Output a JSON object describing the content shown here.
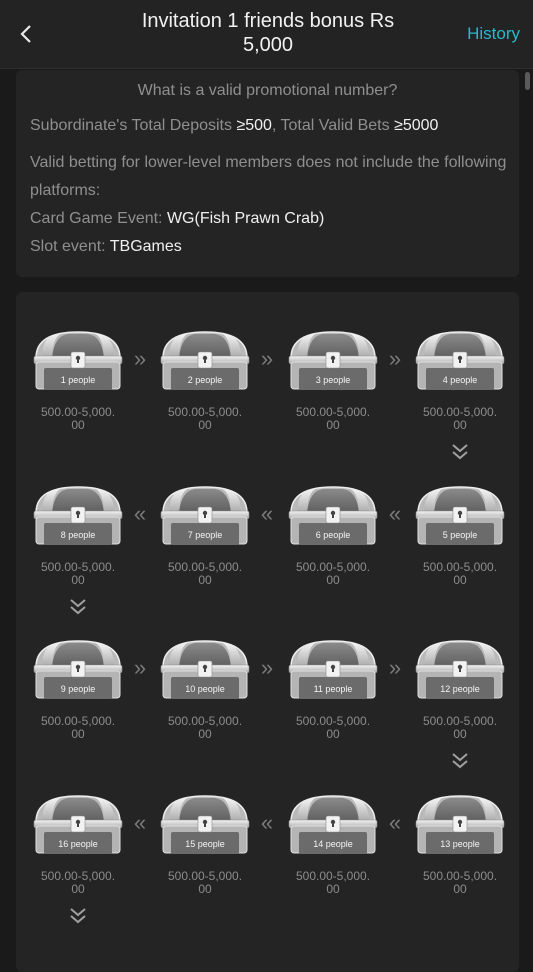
{
  "header": {
    "title_line1": "Invitation 1 friends bonus Rs",
    "title_line2": "5,000",
    "history_label": "History"
  },
  "info": {
    "question": "What is a valid promotional number?",
    "deposits_label": "Subordinate's Total Deposits ",
    "deposits_value": "≥500",
    "bets_label": ",  Total Valid Bets ",
    "bets_value": "≥5000",
    "note_line1": "Valid betting for lower-level members does not include the following",
    "note_line2": "platforms:",
    "card_label": "Card Game Event: ",
    "card_value": "WG(Fish Prawn Crab)",
    "slot_label": "Slot event: ",
    "slot_value": "TBGames"
  },
  "rewards": [
    {
      "label": "1 people",
      "amount_l1": "500.00-5,000.",
      "amount_l2": "00"
    },
    {
      "label": "2 people",
      "amount_l1": "500.00-5,000.",
      "amount_l2": "00"
    },
    {
      "label": "3 people",
      "amount_l1": "500.00-5,000.",
      "amount_l2": "00"
    },
    {
      "label": "4 people",
      "amount_l1": "500.00-5,000.",
      "amount_l2": "00"
    },
    {
      "label": "8 people",
      "amount_l1": "500.00-5,000.",
      "amount_l2": "00"
    },
    {
      "label": "7 people",
      "amount_l1": "500.00-5,000.",
      "amount_l2": "00"
    },
    {
      "label": "6 people",
      "amount_l1": "500.00-5,000.",
      "amount_l2": "00"
    },
    {
      "label": "5 people",
      "amount_l1": "500.00-5,000.",
      "amount_l2": "00"
    },
    {
      "label": "9 people",
      "amount_l1": "500.00-5,000.",
      "amount_l2": "00"
    },
    {
      "label": "10 people",
      "amount_l1": "500.00-5,000.",
      "amount_l2": "00"
    },
    {
      "label": "11 people",
      "amount_l1": "500.00-5,000.",
      "amount_l2": "00"
    },
    {
      "label": "12 people",
      "amount_l1": "500.00-5,000.",
      "amount_l2": "00"
    },
    {
      "label": "16 people",
      "amount_l1": "500.00-5,000.",
      "amount_l2": "00"
    },
    {
      "label": "15 people",
      "amount_l1": "500.00-5,000.",
      "amount_l2": "00"
    },
    {
      "label": "14 people",
      "amount_l1": "500.00-5,000.",
      "amount_l2": "00"
    },
    {
      "label": "13 people",
      "amount_l1": "500.00-5,000.",
      "amount_l2": "00"
    }
  ],
  "arrows": {
    "right": "»",
    "left": "«"
  },
  "colors": {
    "accent": "#26b9c9",
    "background": "#1a1a1a",
    "card": "#242424"
  },
  "icons": [
    "chevron-left-icon",
    "treasure-chest-icon",
    "double-chevron-down-icon"
  ]
}
